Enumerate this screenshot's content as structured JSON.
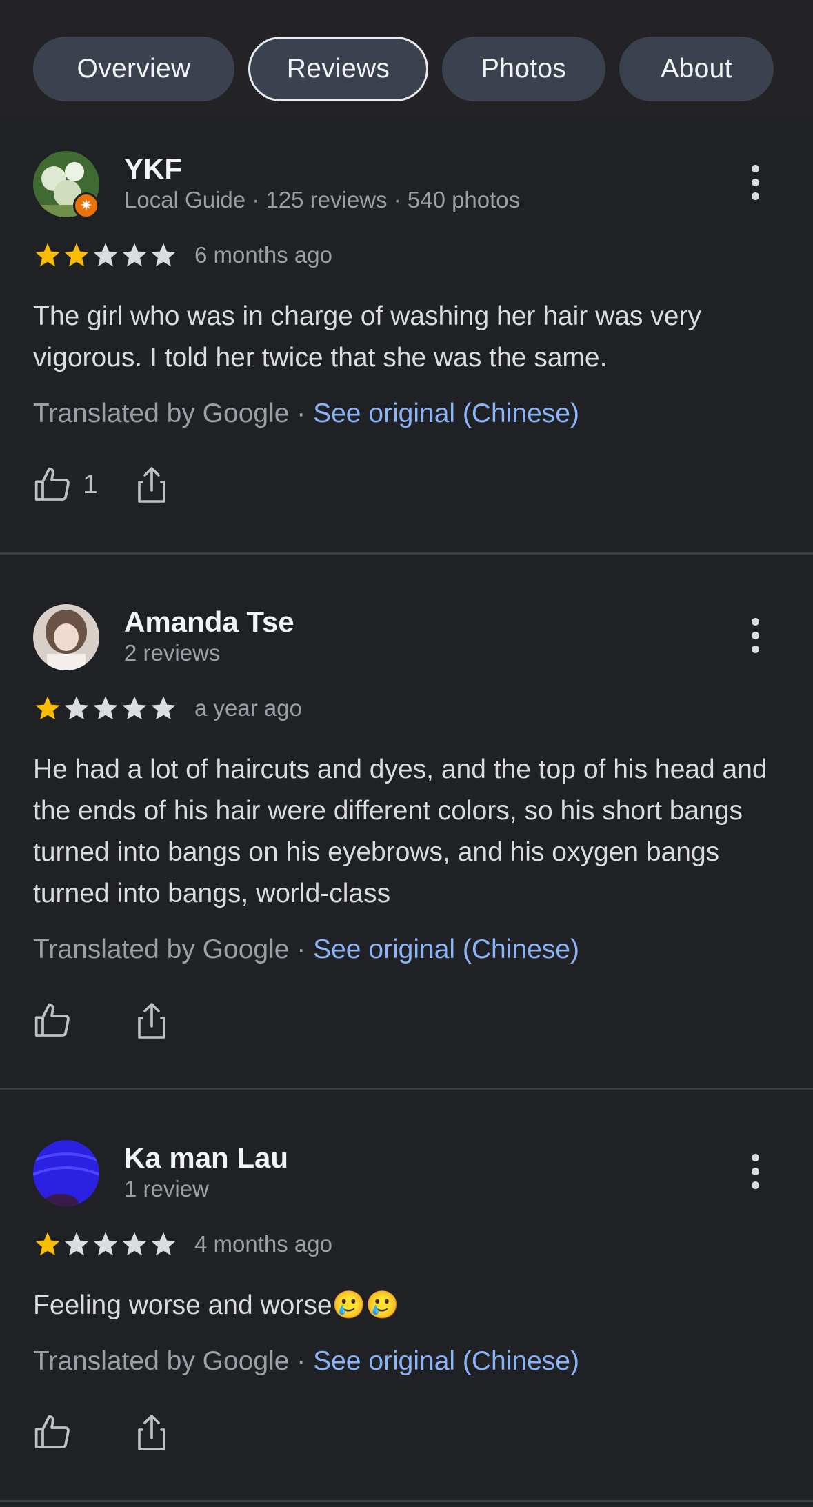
{
  "tabs": [
    {
      "label": "Overview",
      "active": false
    },
    {
      "label": "Reviews",
      "active": true
    },
    {
      "label": "Photos",
      "active": false
    },
    {
      "label": "About",
      "active": false
    }
  ],
  "reviews": [
    {
      "name": "YKF",
      "meta": "Local Guide · 125 reviews · 540 photos",
      "rating": 2,
      "time": "6 months ago",
      "text": "The girl who was in charge of washing her hair was very vigorous. I told her twice that she was the same.",
      "translated": "Translated by Google · ",
      "see_original": "See original (Chinese)",
      "likes": "1",
      "avatar_color": "#4f7a3a"
    },
    {
      "name": "Amanda Tse",
      "meta": "2 reviews",
      "rating": 1,
      "time": "a year ago",
      "text": "He had a lot of haircuts and dyes, and the top of his head and the ends of his hair were different colors, so his short bangs turned into bangs on his eyebrows, and his oxygen bangs turned into bangs, world-class",
      "translated": "Translated by Google · ",
      "see_original": "See original (Chinese)",
      "likes": "",
      "avatar_color": "#c9b8ad"
    },
    {
      "name": "Ka man Lau",
      "meta": "1 review",
      "rating": 1,
      "time": "4 months ago",
      "text": "Feeling worse and worse🥲🥲",
      "translated": "Translated by Google · ",
      "see_original": "See original (Chinese)",
      "likes": "",
      "avatar_color": "#2b21e0"
    }
  ],
  "colors": {
    "star_filled": "#fbbc04",
    "star_empty": "#dadce0",
    "link": "#8ab4f8"
  }
}
